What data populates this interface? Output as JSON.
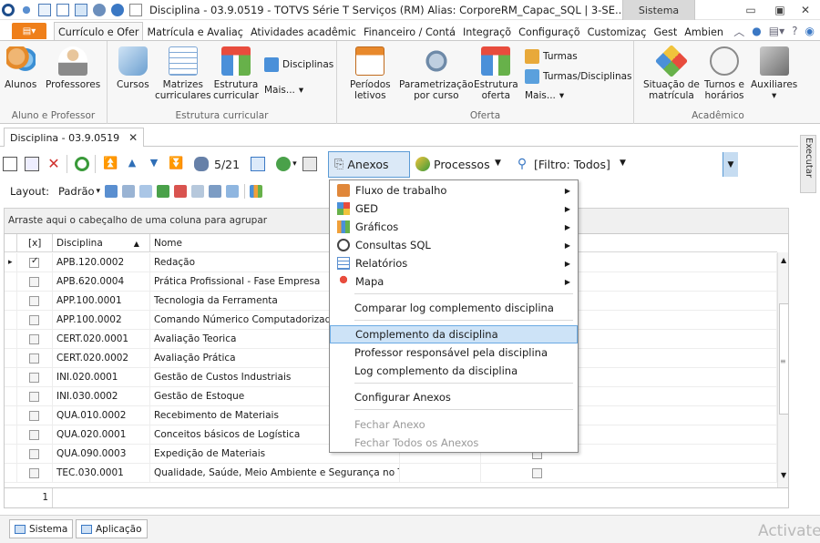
{
  "window": {
    "title": "Disciplina - 03.9.0519 - TOTVS Série T Serviços (RM) Alias: CorporeRM_Capac_SQL | 3-SE...",
    "system_button": "Sistema"
  },
  "ribbon_tabs": [
    "Currículo e Ofer",
    "Matrícula e Avaliaç",
    "Atividades acadêmic",
    "Financeiro / Contá",
    "Integraçõ",
    "Configuraçõ",
    "Customizaç",
    "Gest",
    "Ambien"
  ],
  "ribbon": {
    "aluno_professor": {
      "label": "Aluno e Professor",
      "buttons": [
        "Alunos",
        "Professores"
      ]
    },
    "estrutura": {
      "label": "Estrutura curricular",
      "cursos": "Cursos",
      "matrizes": "Matrizes\ncurriculares",
      "estrutura": "Estrutura\ncurricular",
      "disciplinas": "Disciplinas",
      "mais": "Mais..."
    },
    "oferta": {
      "label": "Oferta",
      "periodos": "Períodos\nletivos",
      "parametrizacao": "Parametrização\npor curso",
      "estrutura_oferta": "Estrutura\noferta",
      "turmas": "Turmas",
      "turmas_disciplinas": "Turmas/Disciplinas",
      "mais": "Mais..."
    },
    "academico": {
      "label": "Acadêmico",
      "situacao": "Situação de\nmatrícula",
      "turnos": "Turnos e\nhorários",
      "auxiliares": "Auxiliares"
    }
  },
  "doc_tab": {
    "label": "Disciplina - 03.9.0519",
    "close": "✕"
  },
  "toolbar": {
    "record_counter": "5/21",
    "anexos": "Anexos",
    "processos": "Processos",
    "filtro": "[Filtro: Todos]",
    "layout_label": "Layout:",
    "layout_value": "Padrão"
  },
  "groupby_hint": "Arraste aqui o cabeçalho de uma coluna para agrupar",
  "grid": {
    "headers": [
      "[x]",
      "Disciplina",
      "Nome"
    ],
    "rows": [
      {
        "code": "APB.120.0002",
        "name": "Redação",
        "checked": true
      },
      {
        "code": "APB.620.0004",
        "name": "Prática Profissional - Fase Empresa",
        "checked": false
      },
      {
        "code": "APP.100.0001",
        "name": "Tecnologia da Ferramenta",
        "checked": false
      },
      {
        "code": "APP.100.0002",
        "name": "Comando Númerico Computadorizado (C",
        "checked": false
      },
      {
        "code": "CERT.020.0001",
        "name": "Avaliação Teorica",
        "checked": false
      },
      {
        "code": "CERT.020.0002",
        "name": "Avaliação Prática",
        "checked": false
      },
      {
        "code": "INI.020.0001",
        "name": "Gestão de Custos Industriais",
        "checked": false
      },
      {
        "code": "INI.030.0002",
        "name": "Gestão de Estoque",
        "checked": false
      },
      {
        "code": "QUA.010.0002",
        "name": "Recebimento de Materiais",
        "checked": false
      },
      {
        "code": "QUA.020.0001",
        "name": "Conceitos básicos de Logística",
        "checked": false
      },
      {
        "code": "QUA.090.0003",
        "name": "Expedição de Materiais",
        "checked": false
      },
      {
        "code": "TEC.030.0001",
        "name": "Qualidade, Saúde, Meio Ambiente e Segurança no Tr...",
        "checked": false
      }
    ],
    "footer_count": "1"
  },
  "menu": {
    "submenus": [
      {
        "label": "Fluxo de trabalho",
        "icon": "workflow-icon"
      },
      {
        "label": "GED",
        "icon": "ged-icon"
      },
      {
        "label": "Gráficos",
        "icon": "chart-icon"
      },
      {
        "label": "Consultas SQL",
        "icon": "sql-icon"
      },
      {
        "label": "Relatórios",
        "icon": "report-icon"
      },
      {
        "label": "Mapa",
        "icon": "map-pin-icon"
      }
    ],
    "comparar": "Comparar log complemento disciplina",
    "complemento": "Complemento da disciplina",
    "professor": "Professor responsável pela disciplina",
    "log": "Log complemento da disciplina",
    "configurar": "Configurar Anexos",
    "fechar": "Fechar Anexo",
    "fechar_todos": "Fechar Todos os Anexos"
  },
  "side_panel": "Executar",
  "bottom_tabs": [
    "Sistema",
    "Aplicação"
  ],
  "watermark": "Activate",
  "colors": {
    "accent": "#5b9bd5",
    "file_tab": "#ef7f1a",
    "selection": "#cde3f7"
  }
}
